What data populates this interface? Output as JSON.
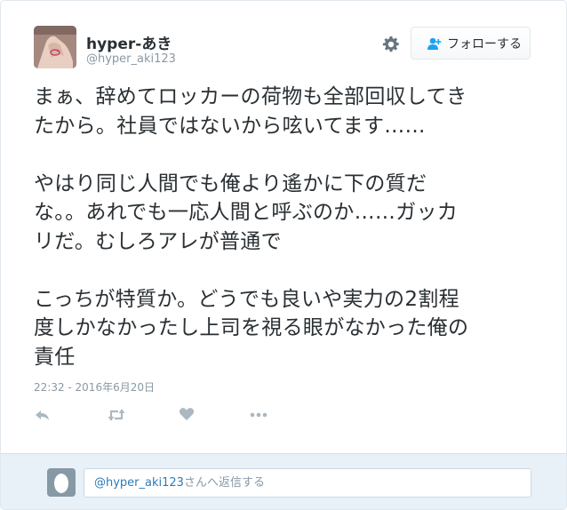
{
  "user": {
    "display_name": "hyper-あき",
    "screen_name": "@hyper_aki123"
  },
  "header": {
    "follow_label": "フォローする",
    "gear_icon": "gear-icon",
    "follow_icon": "add-person-icon"
  },
  "tweet": {
    "text": "まぁ、辞めてロッカーの荷物も全部回収してき\nたから。社員ではないから呟いてます……\n\nやはり同じ人間でも俺より遙かに下の質だ\nな。。あれでも一応人間と呼ぶのか……ガッカ\nリだ。むしろアレが普通で\n\nこっちが特質か。どうでも良いや実力の2割程\n度しかなかったし上司を視る眼がなかった俺の\n責任",
    "timestamp": "22:32 - 2016年6月20日"
  },
  "actions": [
    {
      "name": "reply-icon"
    },
    {
      "name": "retweet-icon"
    },
    {
      "name": "like-heart-icon"
    },
    {
      "name": "more-icon"
    }
  ],
  "reply": {
    "mention": "@hyper_aki123",
    "placeholder_suffix": "さんへ返信する"
  },
  "colors": {
    "text": "#292f33",
    "muted": "#8899a6",
    "icon": "#aab8c2",
    "link": "#2b7bb9",
    "reply_bar": "#e8f1f8"
  }
}
